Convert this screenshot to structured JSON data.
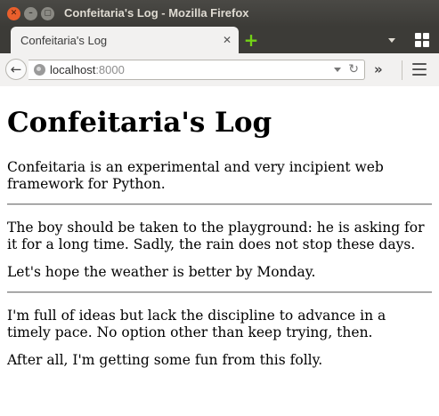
{
  "window": {
    "title": "Confeitaria's Log - Mozilla Firefox",
    "close_glyph": "✕",
    "minimize_glyph": "–",
    "maximize_glyph": "▢"
  },
  "tabs": {
    "active_label": "Confeitaria's Log",
    "close_glyph": "✕",
    "new_tab_glyph": "+"
  },
  "navbar": {
    "back_glyph": "←",
    "url_host": "localhost",
    "url_port": ":8000",
    "reload_glyph": "↻",
    "overflow_glyph": "»"
  },
  "page": {
    "heading": "Confeitaria's Log",
    "intro": "Confeitaria is an experimental and very incipient web framework for Python.",
    "posts": [
      {
        "paragraphs": [
          "The boy should be taken to the playground: he is asking for it for a long time. Sadly, the rain does not stop these days.",
          "Let's hope the weather is better by Monday."
        ]
      },
      {
        "paragraphs": [
          "I'm full of ideas but lack the discipline to advance in a timely pace. No option other than keep trying, then.",
          "After all, I'm getting some fun from this folly."
        ]
      }
    ]
  },
  "colors": {
    "titlebar": "#3c3b37",
    "close_button": "#e95f2c",
    "new_tab_plus": "#73d216",
    "toolbar": "#f2f1f0"
  }
}
